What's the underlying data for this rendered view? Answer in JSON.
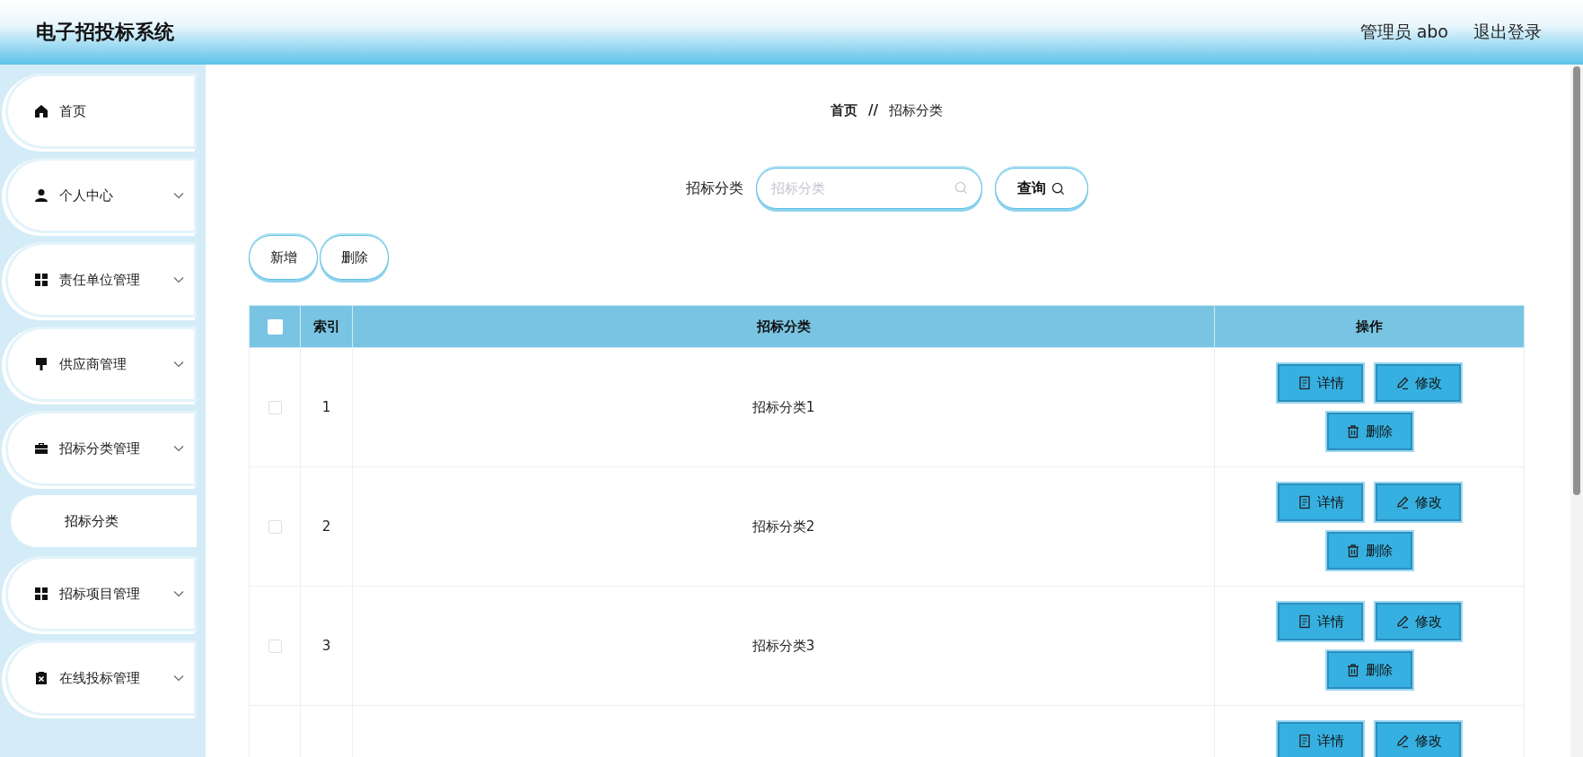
{
  "header": {
    "title": "电子招投标系统",
    "user": "管理员 abo",
    "logout": "退出登录"
  },
  "sidebar": {
    "items": [
      {
        "label": "首页",
        "chevron": false,
        "selected": false
      },
      {
        "label": "个人中心",
        "chevron": true,
        "selected": false
      },
      {
        "label": "责任单位管理",
        "chevron": true,
        "selected": false
      },
      {
        "label": "供应商管理",
        "chevron": true,
        "selected": false
      },
      {
        "label": "招标分类管理",
        "chevron": true,
        "selected": false,
        "children": [
          {
            "label": "招标分类",
            "selected": true
          }
        ]
      },
      {
        "label": "招标项目管理",
        "chevron": true,
        "selected": false
      },
      {
        "label": "在线投标管理",
        "chevron": true,
        "selected": false
      }
    ]
  },
  "breadcrumb": [
    "首页",
    "//",
    "招标分类"
  ],
  "search": {
    "label": "招标分类",
    "placeholder": "招标分类",
    "button": "查询"
  },
  "toolbar": [
    "新增",
    "删除"
  ],
  "table": {
    "select_all_checked": false,
    "columns": [
      "索引",
      "招标分类",
      "操作"
    ],
    "rows": [
      {
        "checked": false,
        "index": "1",
        "name": "招标分类1",
        "actions": [
          {
            "kind": "detail",
            "label": "详情"
          },
          {
            "kind": "edit",
            "label": "修改"
          },
          {
            "kind": "delete",
            "label": "删除"
          }
        ]
      },
      {
        "checked": false,
        "index": "2",
        "name": "招标分类2",
        "actions": [
          {
            "kind": "detail",
            "label": "详情"
          },
          {
            "kind": "edit",
            "label": "修改"
          },
          {
            "kind": "delete",
            "label": "删除"
          }
        ]
      },
      {
        "checked": false,
        "index": "3",
        "name": "招标分类3",
        "actions": [
          {
            "kind": "detail",
            "label": "详情"
          },
          {
            "kind": "edit",
            "label": "修改"
          },
          {
            "kind": "delete",
            "label": "删除"
          }
        ]
      },
      {
        "actions": [
          {
            "kind": "detail",
            "label": "详情"
          },
          {
            "kind": "edit",
            "label": "修改"
          }
        ]
      }
    ]
  }
}
